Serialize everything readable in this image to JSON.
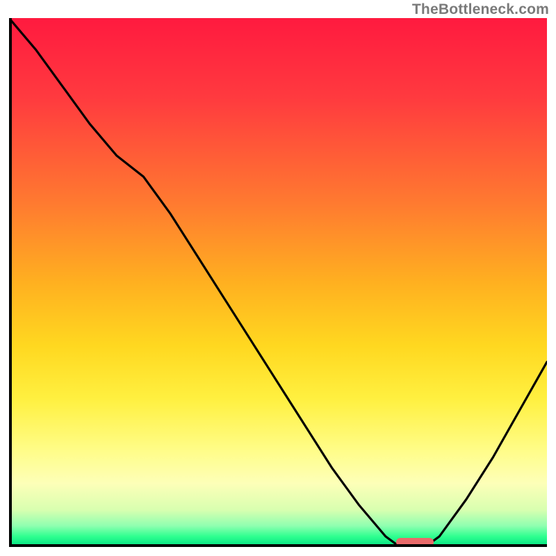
{
  "watermark": "TheBottleneck.com",
  "colors": {
    "frame": "#000000",
    "curve": "#000000",
    "marker": "#e86a6a",
    "watermark": "#7a7a7a"
  },
  "chart_data": {
    "type": "line",
    "title": "",
    "xlabel": "",
    "ylabel": "",
    "xlim": [
      0,
      1
    ],
    "ylim": [
      0,
      1
    ],
    "grid": false,
    "series": [
      {
        "name": "bottleneck-curve",
        "x": [
          0.0,
          0.05,
          0.1,
          0.15,
          0.2,
          0.25,
          0.3,
          0.35,
          0.4,
          0.45,
          0.5,
          0.55,
          0.6,
          0.65,
          0.7,
          0.72,
          0.75,
          0.78,
          0.8,
          0.85,
          0.9,
          0.95,
          1.0
        ],
        "y": [
          1.0,
          0.94,
          0.87,
          0.8,
          0.74,
          0.7,
          0.63,
          0.55,
          0.47,
          0.39,
          0.31,
          0.23,
          0.15,
          0.08,
          0.02,
          0.005,
          0.005,
          0.005,
          0.02,
          0.09,
          0.17,
          0.26,
          0.35
        ]
      }
    ],
    "marker": {
      "x_start": 0.72,
      "x_end": 0.79,
      "y": 0.005
    },
    "annotations": []
  }
}
